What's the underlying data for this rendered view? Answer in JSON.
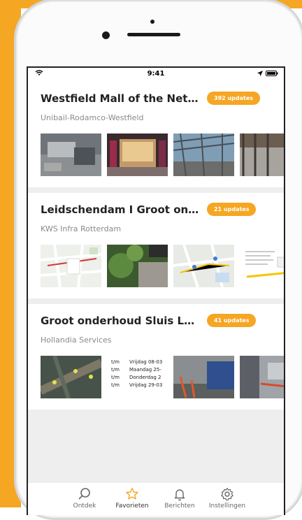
{
  "status": {
    "time": "9:41"
  },
  "colors": {
    "accent": "#f5a623",
    "text": "#222222",
    "muted": "#8a8a8a"
  },
  "projects": [
    {
      "title": "Westfield Mall of the Netherla...",
      "updates": "392 updates",
      "company": "Unibail-Rodamco-Westfield"
    },
    {
      "title": "Leidschendam I Groot onderho...",
      "updates": "21 updates",
      "company": "KWS Infra Rotterdam"
    },
    {
      "title": "Groot onderhoud Sluis Leidsch...",
      "updates": "41 updates",
      "company": "Hollandia Services"
    }
  ],
  "schedule": [
    {
      "a": "t/m",
      "b": "Vrijdag 08-03"
    },
    {
      "a": "t/m",
      "b": "Maandag 25-"
    },
    {
      "a": "t/m",
      "b": "Donderdag 2"
    },
    {
      "a": "t/m",
      "b": "Vrijdag 29-03"
    }
  ],
  "tabs": [
    {
      "label": "Ontdek",
      "icon": "search-icon"
    },
    {
      "label": "Favorieten",
      "icon": "star-icon"
    },
    {
      "label": "Berichten",
      "icon": "bell-icon"
    },
    {
      "label": "Instellingen",
      "icon": "gear-icon"
    }
  ]
}
